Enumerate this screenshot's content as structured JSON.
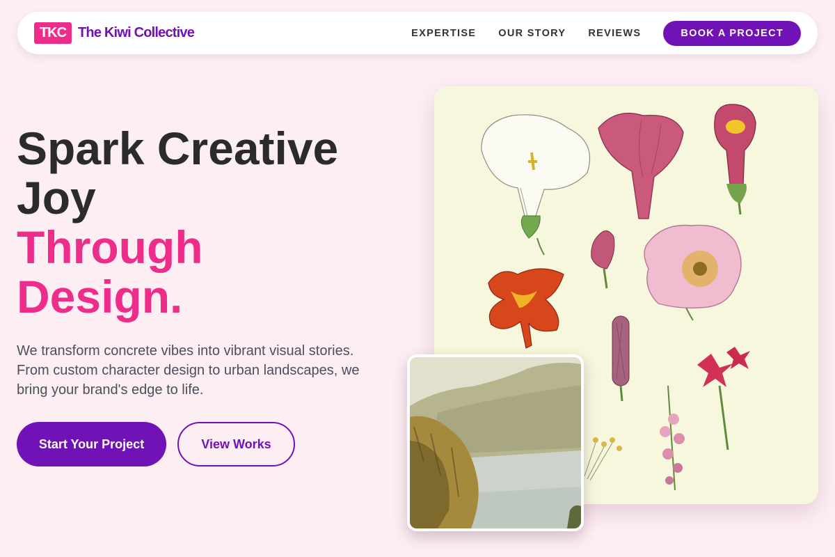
{
  "brand": {
    "badge": "TKC",
    "name": "The Kiwi Collective"
  },
  "nav": {
    "links": [
      "EXPERTISE",
      "OUR STORY",
      "REVIEWS"
    ],
    "cta": "BOOK A PROJECT"
  },
  "hero": {
    "headline_line1": "Spark Creative",
    "headline_line2": "Joy",
    "headline_accent_line1": "Through",
    "headline_accent_line2": "Design.",
    "lead": "We transform concrete vibes into vibrant visual stories. From custom character design to urban landscapes, we bring your brand's edge to life.",
    "primary_button": "Start Your Project",
    "secondary_button": "View Works"
  },
  "colors": {
    "background": "#fdeef4",
    "accent_pink": "#ee2d8a",
    "brand_purple": "#7012b6",
    "text_dark": "#2b2b2b"
  },
  "images": {
    "main": "botanical-flowers-illustration",
    "inset": "lake-cliff-landscape-illustration"
  }
}
